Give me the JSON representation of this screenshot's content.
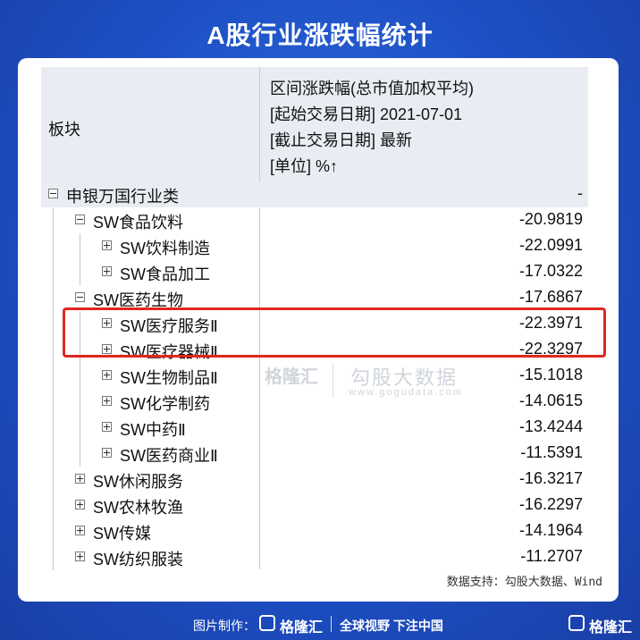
{
  "title": "A股行业涨跌幅统计",
  "header": {
    "left": "板块",
    "right_lines": [
      "区间涨跌幅(总市值加权平均)",
      "[起始交易日期] 2021-07-01",
      "[截止交易日期] 最新",
      "[单位] %↑"
    ]
  },
  "rows": [
    {
      "name": "申银万国行业类",
      "value": "-",
      "level": 0,
      "expanded": true
    },
    {
      "name": "SW食品饮料",
      "value": "-20.9819",
      "level": 1,
      "expanded": true
    },
    {
      "name": "SW饮料制造",
      "value": "-22.0991",
      "level": 2,
      "expanded": false
    },
    {
      "name": "SW食品加工",
      "value": "-17.0322",
      "level": 2,
      "expanded": false
    },
    {
      "name": "SW医药生物",
      "value": "-17.6867",
      "level": 1,
      "expanded": true
    },
    {
      "name": "SW医疗服务Ⅱ",
      "value": "-22.3971",
      "level": 2,
      "expanded": false
    },
    {
      "name": "SW医疗器械Ⅱ",
      "value": "-22.3297",
      "level": 2,
      "expanded": false
    },
    {
      "name": "SW生物制品Ⅱ",
      "value": "-15.1018",
      "level": 2,
      "expanded": false
    },
    {
      "name": "SW化学制药",
      "value": "-14.0615",
      "level": 2,
      "expanded": false
    },
    {
      "name": "SW中药Ⅱ",
      "value": "-13.4244",
      "level": 2,
      "expanded": false
    },
    {
      "name": "SW医药商业Ⅱ",
      "value": "-11.5391",
      "level": 2,
      "expanded": false
    },
    {
      "name": "SW休闲服务",
      "value": "-16.3217",
      "level": 1,
      "expanded": false
    },
    {
      "name": "SW农林牧渔",
      "value": "-16.2297",
      "level": 1,
      "expanded": false
    },
    {
      "name": "SW传媒",
      "value": "-14.1964",
      "level": 1,
      "expanded": false
    },
    {
      "name": "SW纺织服装",
      "value": "-11.2707",
      "level": 1,
      "expanded": false
    }
  ],
  "watermark": {
    "brand": "格隆汇",
    "brand_url": "www.gelonghui.com",
    "name": "勾股大数据",
    "url": "www.gogudata.com"
  },
  "source": "数据支持：勾股大数据、Wind",
  "footer": {
    "made_by": "图片制作：",
    "logo": "格隆汇",
    "slogan": "全球视野 下注中国",
    "corner_logo": "格隆汇"
  },
  "colors": {
    "background": "#1d4fc4",
    "highlight": "#e0271f",
    "header_bg": "#e9edf3"
  }
}
